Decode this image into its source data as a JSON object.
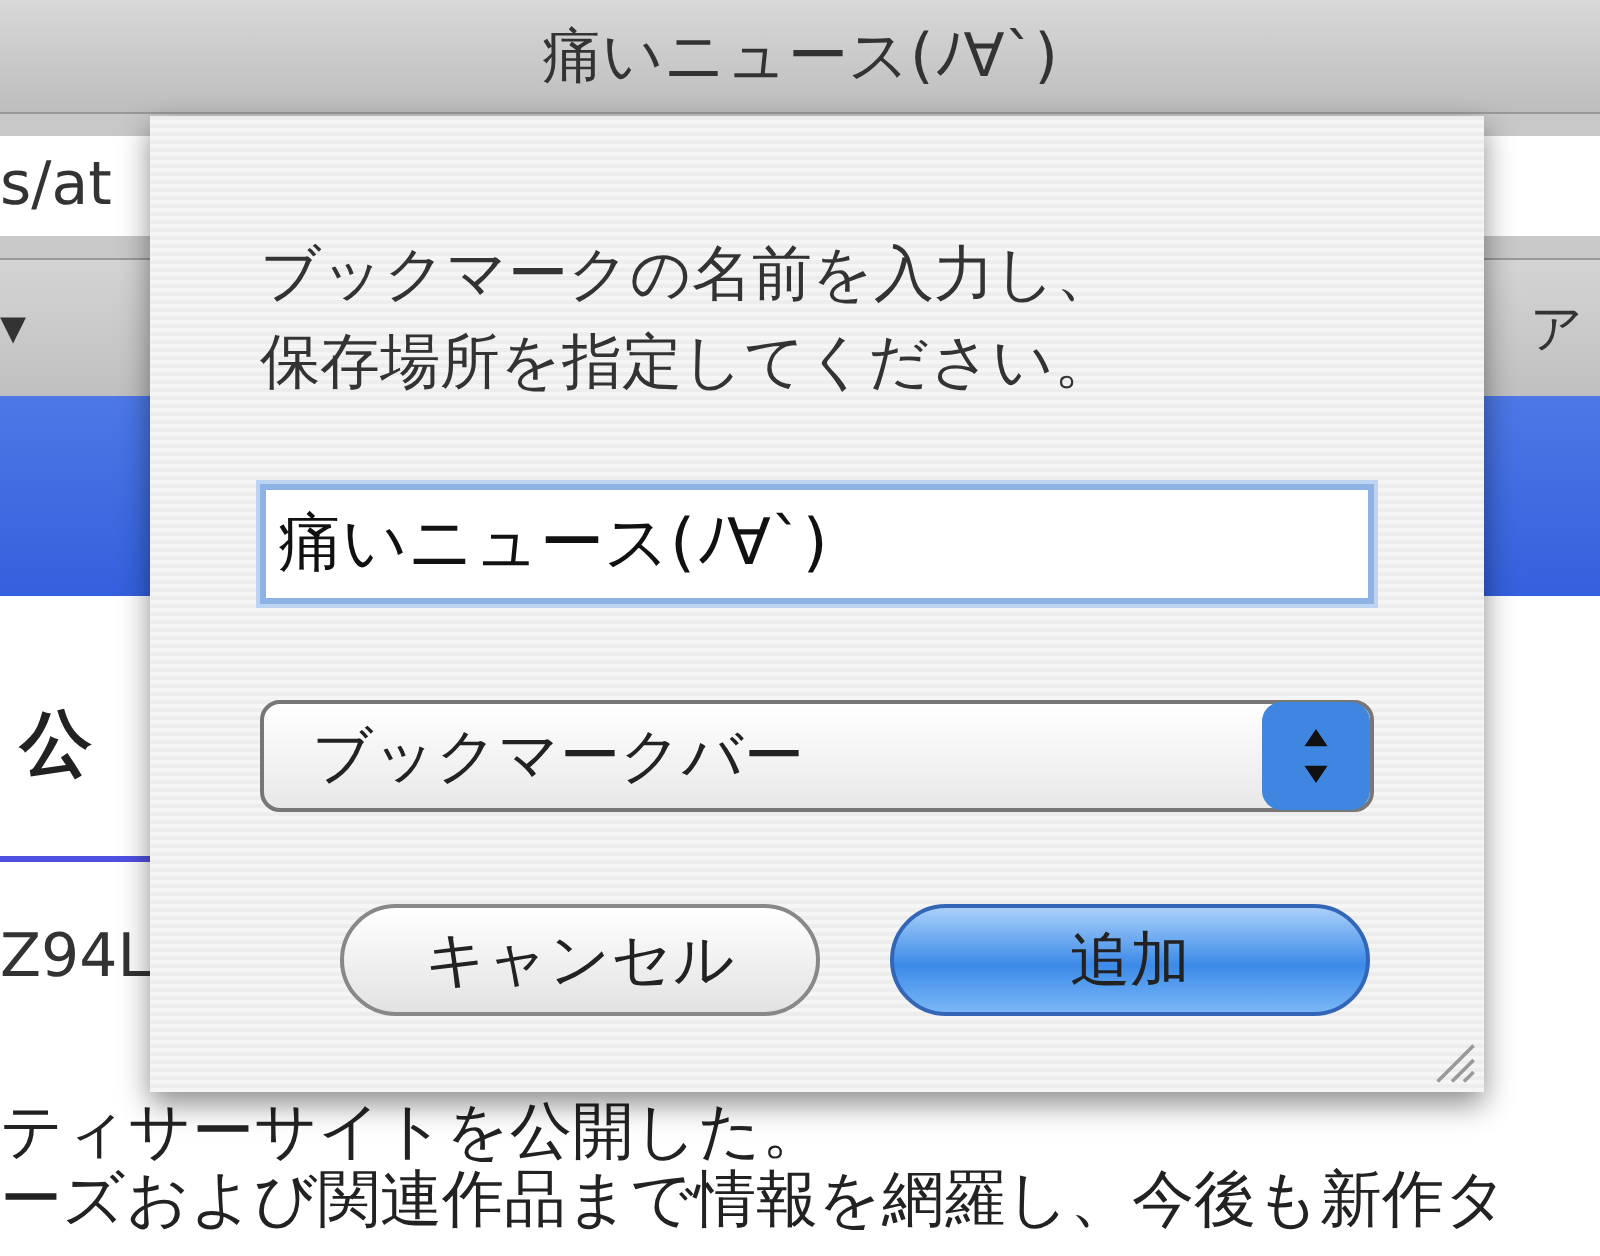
{
  "window": {
    "title": "痛いニュース(ﾉ∀`)"
  },
  "address_bar": {
    "value": "s/at"
  },
  "bookmarks_bar": {
    "left_item": "▾",
    "right_item": "ア"
  },
  "page": {
    "heading": "公",
    "code": "Z94L",
    "lines": [
      "ティサーサイトを公開した。",
      "ーズおよび関連作品まで情報を網羅し、今後も新作タ"
    ]
  },
  "sheet": {
    "message_lines": [
      "ブックマークの名前を入力し、",
      "保存場所を指定してください。"
    ],
    "name_field": {
      "value": "痛いニュース(ﾉ∀`)"
    },
    "location_popup": {
      "value": "ブックマークバー"
    },
    "buttons": [
      {
        "label": "キャンセル",
        "default": false
      },
      {
        "label": "追加",
        "default": true
      }
    ]
  }
}
